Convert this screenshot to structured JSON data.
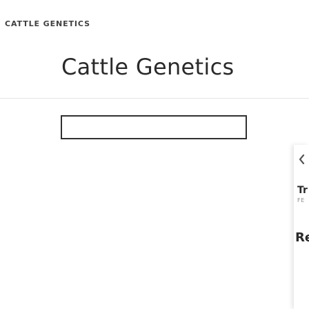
{
  "header": {
    "breadcrumb": "CATTLE GENETICS",
    "title": "Cattle Genetics"
  },
  "filter": {
    "selected_value": ""
  },
  "side_panel": {
    "back_icon": "chevron-left-icon",
    "title": "Tr",
    "subtitle": "FE",
    "heading": "Re"
  }
}
